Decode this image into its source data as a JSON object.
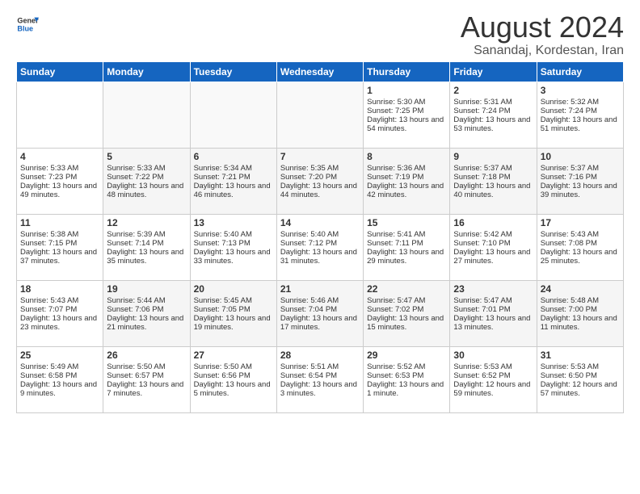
{
  "logo": {
    "line1": "General",
    "line2": "Blue"
  },
  "title": "August 2024",
  "subtitle": "Sanandaj, Kordestan, Iran",
  "headers": [
    "Sunday",
    "Monday",
    "Tuesday",
    "Wednesday",
    "Thursday",
    "Friday",
    "Saturday"
  ],
  "weeks": [
    [
      {
        "day": "",
        "sunrise": "",
        "sunset": "",
        "daylight": ""
      },
      {
        "day": "",
        "sunrise": "",
        "sunset": "",
        "daylight": ""
      },
      {
        "day": "",
        "sunrise": "",
        "sunset": "",
        "daylight": ""
      },
      {
        "day": "",
        "sunrise": "",
        "sunset": "",
        "daylight": ""
      },
      {
        "day": "1",
        "sunrise": "Sunrise: 5:30 AM",
        "sunset": "Sunset: 7:25 PM",
        "daylight": "Daylight: 13 hours and 54 minutes."
      },
      {
        "day": "2",
        "sunrise": "Sunrise: 5:31 AM",
        "sunset": "Sunset: 7:24 PM",
        "daylight": "Daylight: 13 hours and 53 minutes."
      },
      {
        "day": "3",
        "sunrise": "Sunrise: 5:32 AM",
        "sunset": "Sunset: 7:24 PM",
        "daylight": "Daylight: 13 hours and 51 minutes."
      }
    ],
    [
      {
        "day": "4",
        "sunrise": "Sunrise: 5:33 AM",
        "sunset": "Sunset: 7:23 PM",
        "daylight": "Daylight: 13 hours and 49 minutes."
      },
      {
        "day": "5",
        "sunrise": "Sunrise: 5:33 AM",
        "sunset": "Sunset: 7:22 PM",
        "daylight": "Daylight: 13 hours and 48 minutes."
      },
      {
        "day": "6",
        "sunrise": "Sunrise: 5:34 AM",
        "sunset": "Sunset: 7:21 PM",
        "daylight": "Daylight: 13 hours and 46 minutes."
      },
      {
        "day": "7",
        "sunrise": "Sunrise: 5:35 AM",
        "sunset": "Sunset: 7:20 PM",
        "daylight": "Daylight: 13 hours and 44 minutes."
      },
      {
        "day": "8",
        "sunrise": "Sunrise: 5:36 AM",
        "sunset": "Sunset: 7:19 PM",
        "daylight": "Daylight: 13 hours and 42 minutes."
      },
      {
        "day": "9",
        "sunrise": "Sunrise: 5:37 AM",
        "sunset": "Sunset: 7:18 PM",
        "daylight": "Daylight: 13 hours and 40 minutes."
      },
      {
        "day": "10",
        "sunrise": "Sunrise: 5:37 AM",
        "sunset": "Sunset: 7:16 PM",
        "daylight": "Daylight: 13 hours and 39 minutes."
      }
    ],
    [
      {
        "day": "11",
        "sunrise": "Sunrise: 5:38 AM",
        "sunset": "Sunset: 7:15 PM",
        "daylight": "Daylight: 13 hours and 37 minutes."
      },
      {
        "day": "12",
        "sunrise": "Sunrise: 5:39 AM",
        "sunset": "Sunset: 7:14 PM",
        "daylight": "Daylight: 13 hours and 35 minutes."
      },
      {
        "day": "13",
        "sunrise": "Sunrise: 5:40 AM",
        "sunset": "Sunset: 7:13 PM",
        "daylight": "Daylight: 13 hours and 33 minutes."
      },
      {
        "day": "14",
        "sunrise": "Sunrise: 5:40 AM",
        "sunset": "Sunset: 7:12 PM",
        "daylight": "Daylight: 13 hours and 31 minutes."
      },
      {
        "day": "15",
        "sunrise": "Sunrise: 5:41 AM",
        "sunset": "Sunset: 7:11 PM",
        "daylight": "Daylight: 13 hours and 29 minutes."
      },
      {
        "day": "16",
        "sunrise": "Sunrise: 5:42 AM",
        "sunset": "Sunset: 7:10 PM",
        "daylight": "Daylight: 13 hours and 27 minutes."
      },
      {
        "day": "17",
        "sunrise": "Sunrise: 5:43 AM",
        "sunset": "Sunset: 7:08 PM",
        "daylight": "Daylight: 13 hours and 25 minutes."
      }
    ],
    [
      {
        "day": "18",
        "sunrise": "Sunrise: 5:43 AM",
        "sunset": "Sunset: 7:07 PM",
        "daylight": "Daylight: 13 hours and 23 minutes."
      },
      {
        "day": "19",
        "sunrise": "Sunrise: 5:44 AM",
        "sunset": "Sunset: 7:06 PM",
        "daylight": "Daylight: 13 hours and 21 minutes."
      },
      {
        "day": "20",
        "sunrise": "Sunrise: 5:45 AM",
        "sunset": "Sunset: 7:05 PM",
        "daylight": "Daylight: 13 hours and 19 minutes."
      },
      {
        "day": "21",
        "sunrise": "Sunrise: 5:46 AM",
        "sunset": "Sunset: 7:04 PM",
        "daylight": "Daylight: 13 hours and 17 minutes."
      },
      {
        "day": "22",
        "sunrise": "Sunrise: 5:47 AM",
        "sunset": "Sunset: 7:02 PM",
        "daylight": "Daylight: 13 hours and 15 minutes."
      },
      {
        "day": "23",
        "sunrise": "Sunrise: 5:47 AM",
        "sunset": "Sunset: 7:01 PM",
        "daylight": "Daylight: 13 hours and 13 minutes."
      },
      {
        "day": "24",
        "sunrise": "Sunrise: 5:48 AM",
        "sunset": "Sunset: 7:00 PM",
        "daylight": "Daylight: 13 hours and 11 minutes."
      }
    ],
    [
      {
        "day": "25",
        "sunrise": "Sunrise: 5:49 AM",
        "sunset": "Sunset: 6:58 PM",
        "daylight": "Daylight: 13 hours and 9 minutes."
      },
      {
        "day": "26",
        "sunrise": "Sunrise: 5:50 AM",
        "sunset": "Sunset: 6:57 PM",
        "daylight": "Daylight: 13 hours and 7 minutes."
      },
      {
        "day": "27",
        "sunrise": "Sunrise: 5:50 AM",
        "sunset": "Sunset: 6:56 PM",
        "daylight": "Daylight: 13 hours and 5 minutes."
      },
      {
        "day": "28",
        "sunrise": "Sunrise: 5:51 AM",
        "sunset": "Sunset: 6:54 PM",
        "daylight": "Daylight: 13 hours and 3 minutes."
      },
      {
        "day": "29",
        "sunrise": "Sunrise: 5:52 AM",
        "sunset": "Sunset: 6:53 PM",
        "daylight": "Daylight: 13 hours and 1 minute."
      },
      {
        "day": "30",
        "sunrise": "Sunrise: 5:53 AM",
        "sunset": "Sunset: 6:52 PM",
        "daylight": "Daylight: 12 hours and 59 minutes."
      },
      {
        "day": "31",
        "sunrise": "Sunrise: 5:53 AM",
        "sunset": "Sunset: 6:50 PM",
        "daylight": "Daylight: 12 hours and 57 minutes."
      }
    ]
  ]
}
